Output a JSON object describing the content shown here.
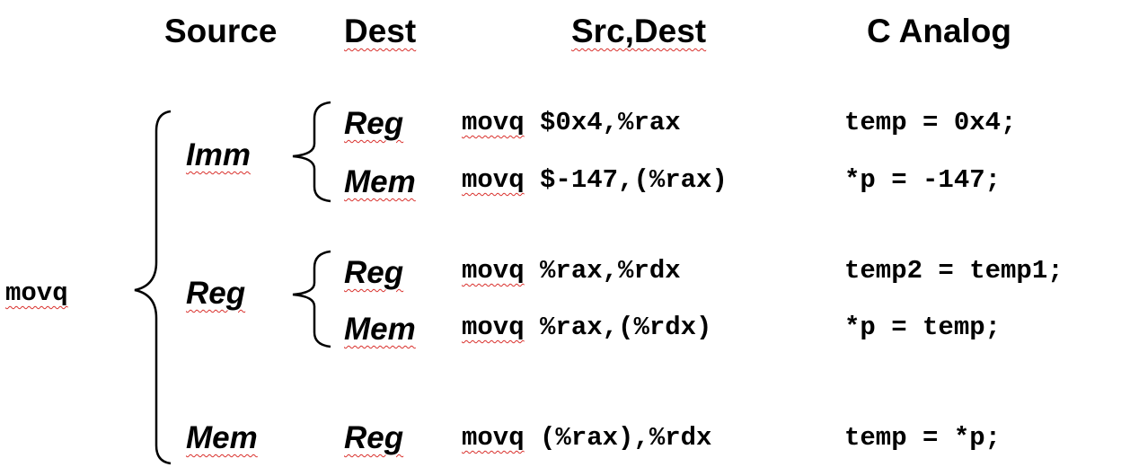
{
  "headers": {
    "source": "Source",
    "dest": "Dest",
    "src_dest": "Src,Dest",
    "c_analog": "C Analog"
  },
  "instruction": "movq",
  "operands": {
    "imm": "Imm",
    "reg": "Reg",
    "mem": "Mem"
  },
  "rows": [
    {
      "source": "Imm",
      "dest": "Reg",
      "asm_op": "movq",
      "asm_args": "$0x4,%rax",
      "c_code": "temp = 0x4;"
    },
    {
      "source": "Imm",
      "dest": "Mem",
      "asm_op": "movq",
      "asm_args": "$-147,(%rax)",
      "c_code": "*p = -147;"
    },
    {
      "source": "Reg",
      "dest": "Reg",
      "asm_op": "movq",
      "asm_args": "%rax,%rdx",
      "c_code": "temp2 = temp1;"
    },
    {
      "source": "Reg",
      "dest": "Mem",
      "asm_op": "movq",
      "asm_args": "%rax,(%rdx)",
      "c_code": "*p = temp;"
    },
    {
      "source": "Mem",
      "dest": "Reg",
      "asm_op": "movq",
      "asm_args": "(%rax),%rdx",
      "c_code": "temp = *p;"
    }
  ]
}
